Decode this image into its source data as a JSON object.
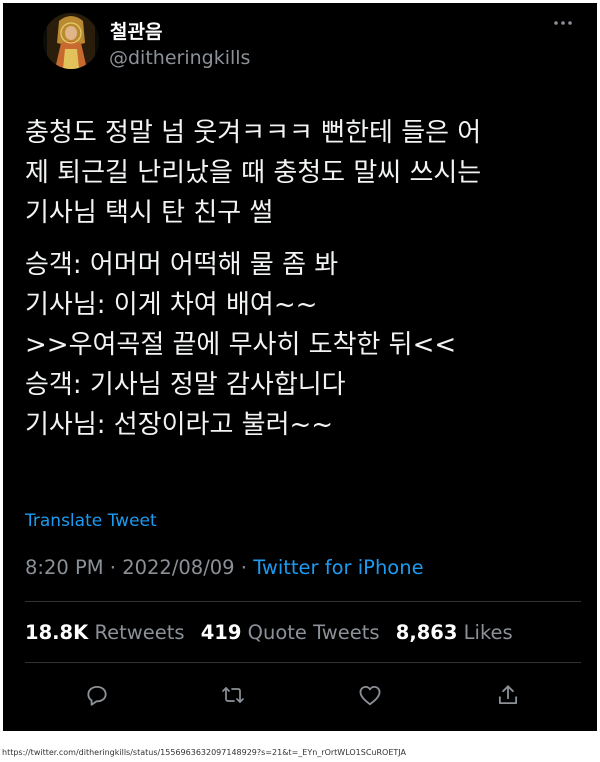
{
  "user": {
    "display_name": "철관음",
    "handle": "@ditheringkills"
  },
  "tweet": {
    "paragraphs": [
      "충청도 정말 넘 웃겨ㅋㅋㅋ 뻔한테 들은 어\n제 퇴근길 난리났을 때 충청도 말씨 쓰시는\n기사님 택시 탄 친구 썰",
      "승객: 어머머 어떡해 물 좀 봐\n기사님: 이게 차여 배여~~\n>>우여곡절 끝에 무사히 도착한 뒤<<\n승객: 기사님 정말 감사합니다\n기사님: 선장이라고 불러~~"
    ],
    "translate_label": "Translate Tweet",
    "time": "8:20 PM",
    "date": "2022/08/09",
    "separator": "·",
    "source": "Twitter for iPhone"
  },
  "stats": {
    "retweets_count": "18.8K",
    "retweets_label": "Retweets",
    "quotes_count": "419",
    "quotes_label": "Quote Tweets",
    "likes_count": "8,863",
    "likes_label": "Likes"
  },
  "actions": [
    "reply-icon",
    "retweet-icon",
    "like-icon",
    "share-icon"
  ],
  "colors": {
    "background": "#000000",
    "text": "#e7e9ea",
    "secondary": "#8b9197",
    "link": "#1d9bf0",
    "divider": "#2f3336"
  },
  "footer": {
    "url": "https://twitter.com/ditheringkills/status/1556963632097148929?s=21&t=_EYn_rOrtWLO1SCuROETJA"
  }
}
